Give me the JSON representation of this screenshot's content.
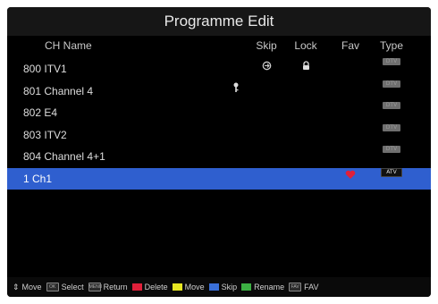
{
  "title": "Programme Edit",
  "columns": {
    "name": "CH Name",
    "skip": "Skip",
    "lock": "Lock",
    "fav": "Fav",
    "type": "Type"
  },
  "channels": [
    {
      "label": "800 ITV1",
      "skip": true,
      "lock": true,
      "fav": false,
      "key": false,
      "type": "DTV",
      "selected": false
    },
    {
      "label": "801 Channel 4",
      "skip": false,
      "lock": false,
      "fav": false,
      "key": true,
      "type": "DTV",
      "selected": false
    },
    {
      "label": "802 E4",
      "skip": false,
      "lock": false,
      "fav": false,
      "key": false,
      "type": "DTV",
      "selected": false
    },
    {
      "label": "803 ITV2",
      "skip": false,
      "lock": false,
      "fav": false,
      "key": false,
      "type": "DTV",
      "selected": false
    },
    {
      "label": "804 Channel 4+1",
      "skip": false,
      "lock": false,
      "fav": false,
      "key": false,
      "type": "DTV",
      "selected": false
    },
    {
      "label": "1 Ch1",
      "skip": false,
      "lock": false,
      "fav": true,
      "key": false,
      "type": "ATV",
      "selected": true
    }
  ],
  "footer": {
    "move_nav": "Move",
    "select": "Select",
    "return": "Return",
    "delete": "Delete",
    "move": "Move",
    "skip": "Skip",
    "rename": "Rename",
    "fav": "FAV",
    "ok_key": "OK",
    "menu_key": "MENU",
    "fav_key": "FAV"
  },
  "colors": {
    "red": "#e0203a",
    "yellow": "#e6e622",
    "blue": "#3a6fd8",
    "green": "#3cb043",
    "highlight": "#2f5fcf"
  }
}
